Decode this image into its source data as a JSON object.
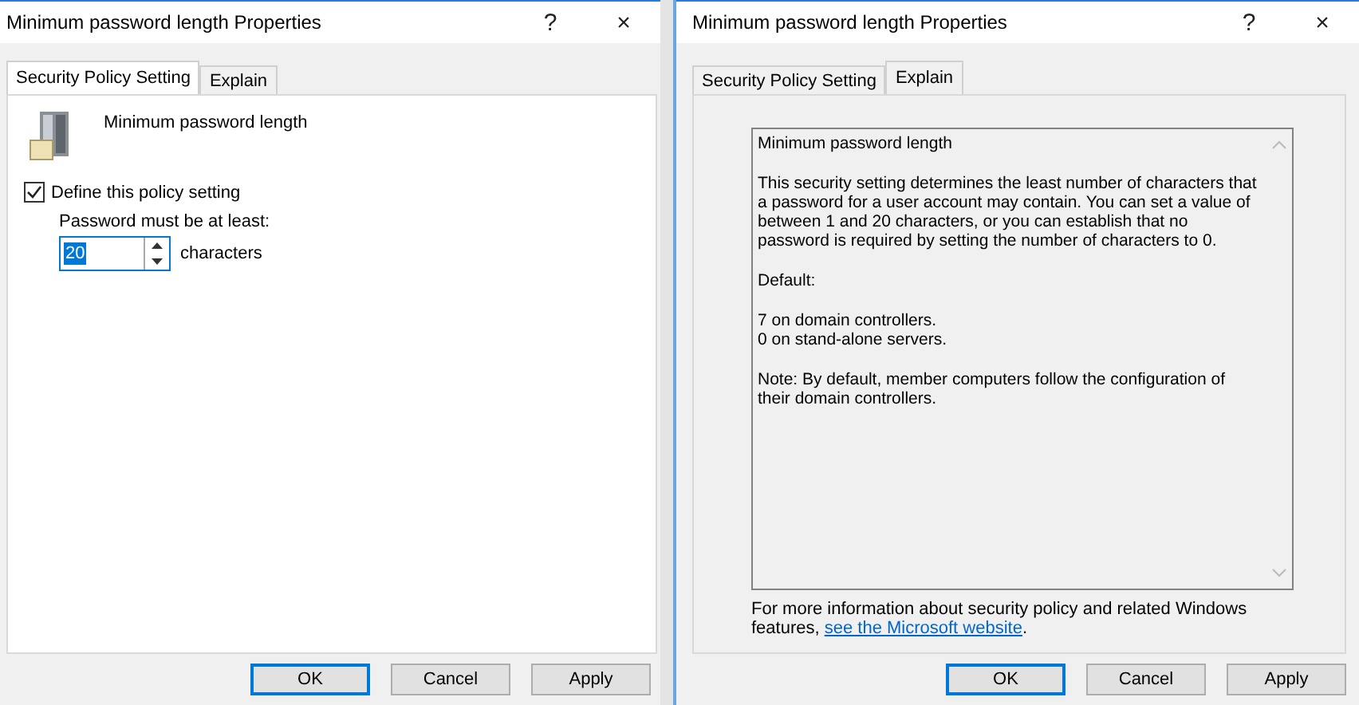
{
  "left_dialog": {
    "title": "Minimum password length Properties",
    "help": "?",
    "close": "×",
    "tabs": [
      {
        "label": "Security Policy Setting",
        "selected": true
      },
      {
        "label": "Explain",
        "selected": false
      }
    ],
    "policy_name": "Minimum password length",
    "define_checkbox": {
      "label": "Define this policy setting",
      "checked": true
    },
    "length_label": "Password must be at least:",
    "length_field": {
      "value": "20",
      "selected": true
    },
    "unit": "characters",
    "buttons": [
      {
        "label": "OK",
        "default": true
      },
      {
        "label": "Cancel",
        "default": false
      },
      {
        "label": "Apply",
        "default": false
      }
    ]
  },
  "right_dialog": {
    "title": "Minimum password length Properties",
    "help": "?",
    "close": "×",
    "tabs": [
      {
        "label": "Security Policy Setting",
        "selected": false
      },
      {
        "label": "Explain",
        "selected": true
      }
    ],
    "explain_paragraphs": [
      [
        "Minimum password length"
      ],
      [
        "This security setting determines the least number of characters that a password for a user account may contain. You can set a value of between 1 and 20 characters, or you can establish that no password is required by setting the number of characters to 0."
      ],
      [
        "Default:"
      ],
      [
        "7 on domain controllers.",
        "0 on stand-alone servers."
      ],
      [
        "Note: By default, member computers follow the configuration of their domain controllers."
      ]
    ],
    "more_info": {
      "before": "For more information about security policy and related Windows features, ",
      "link": "see the Microsoft website",
      "after": "."
    },
    "buttons": [
      {
        "label": "OK",
        "default": true
      },
      {
        "label": "Cancel",
        "default": false
      },
      {
        "label": "Apply",
        "default": false
      }
    ]
  }
}
